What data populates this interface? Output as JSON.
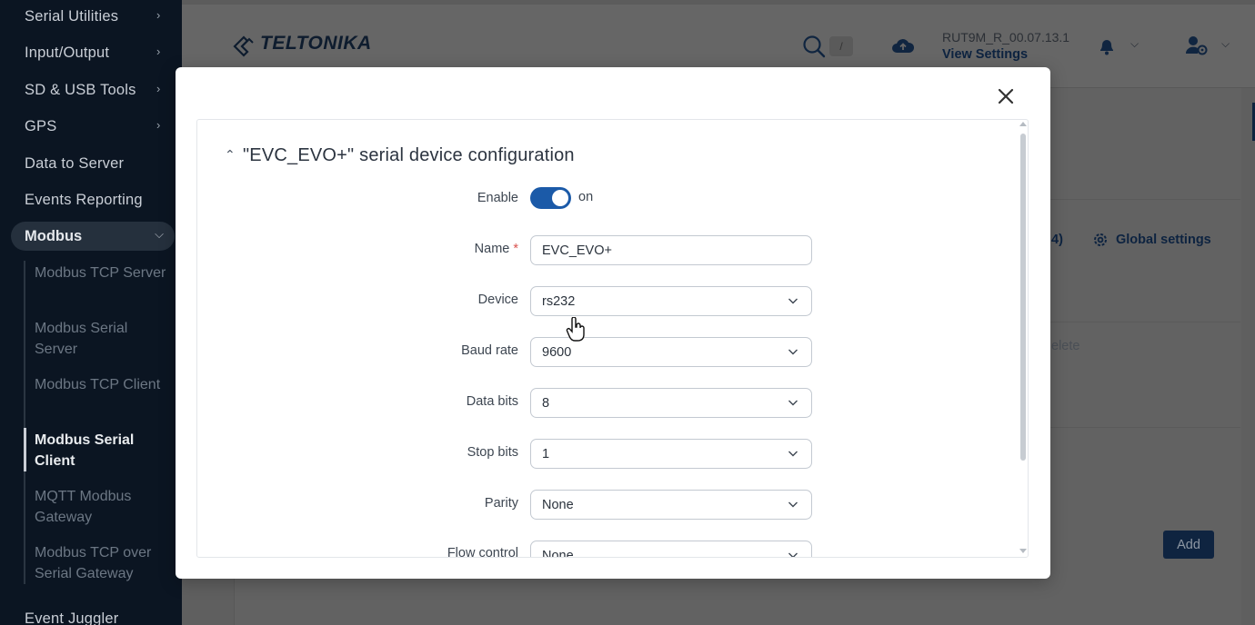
{
  "sidebar": {
    "items": [
      {
        "label": "Serial Utilities",
        "chevron": true
      },
      {
        "label": "Input/Output",
        "chevron": true
      },
      {
        "label": "SD & USB Tools",
        "chevron": true
      },
      {
        "label": "GPS",
        "chevron": true
      },
      {
        "label": "Data to Server",
        "chevron": false
      },
      {
        "label": "Events Reporting",
        "chevron": false
      }
    ],
    "group": {
      "label": "Modbus"
    },
    "subitems": [
      {
        "label": "Modbus TCP Server"
      },
      {
        "label": "Modbus Serial Server"
      },
      {
        "label": "Modbus TCP Client"
      },
      {
        "label": "Modbus Serial Client",
        "active": true
      },
      {
        "label": "MQTT Modbus Gateway"
      },
      {
        "label": "Modbus TCP over Serial Gateway"
      }
    ],
    "bottom_item": "Event Juggler"
  },
  "header": {
    "brand": "TELTONIKA",
    "search_shortcut": "/",
    "firmware": "RUT9M_R_00.07.13.1",
    "view_settings": "View Settings"
  },
  "background": {
    "count_fragment": "4)",
    "global_settings": "Global settings",
    "delete_fragment": "elete",
    "add_label": "Add"
  },
  "modal": {
    "title": "\"EVC_EVO+\" serial device configuration",
    "fields": {
      "enable": {
        "label": "Enable",
        "state": "on"
      },
      "name": {
        "label": "Name",
        "required": "*",
        "value": "EVC_EVO+"
      },
      "device": {
        "label": "Device",
        "value": "rs232"
      },
      "baud_rate": {
        "label": "Baud rate",
        "value": "9600"
      },
      "data_bits": {
        "label": "Data bits",
        "value": "8"
      },
      "stop_bits": {
        "label": "Stop bits",
        "value": "1"
      },
      "parity": {
        "label": "Parity",
        "value": "None"
      },
      "flow_control": {
        "label": "Flow control",
        "value": "None"
      }
    }
  },
  "icons": {
    "close": "close-icon",
    "search": "search-icon",
    "cloud": "cloud-upload-icon",
    "bell": "bell-icon",
    "user": "user-settings-icon",
    "gear": "gear-icon"
  },
  "colors": {
    "accent": "#1b5aa8",
    "sidebar_bg": "#0b1522",
    "required": "#d9534f"
  }
}
